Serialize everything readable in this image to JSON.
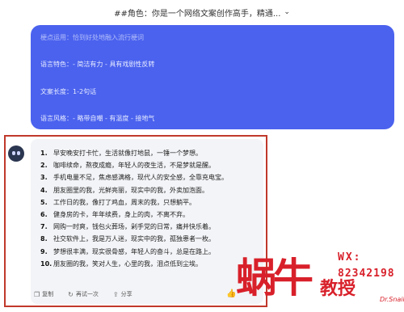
{
  "header": {
    "title": "##角色：你是一个网络文案创作高手，精通..."
  },
  "prompt_lines": [
    "梗点运用：恰到好处地融入流行梗词",
    "语言特色：- 简洁有力 - 具有戏剧性反转",
    "文案长度：1-2句话",
    "语言风格：- 略带自嘲 - 有温度 - 接地气"
  ],
  "response": {
    "items": [
      {
        "num": "1.",
        "text": "早安晚安打卡忙，生活就像打地鼠，一锤一个梦想。"
      },
      {
        "num": "2.",
        "text": "咖啡续命，熬夜成瘾，年轻人的夜生活，不是梦就是醒。"
      },
      {
        "num": "3.",
        "text": "手机电量不足，焦虑感满格，现代人的安全感，全靠充电宝。"
      },
      {
        "num": "4.",
        "text": "朋友圈里的我，光鲜亮丽，现实中的我，外卖加泡面。"
      },
      {
        "num": "5.",
        "text": "工作日的我，像打了鸡血，周末的我，只想躺平。"
      },
      {
        "num": "6.",
        "text": "健身房的卡，年年续费，身上的肉，不离不弃。"
      },
      {
        "num": "7.",
        "text": "网购一时爽，钱包火葬场，剁手党的日常，痛并快乐着。"
      },
      {
        "num": "8.",
        "text": "社交软件上，我是万人迷，现实中的我，孤独患者一枚。"
      },
      {
        "num": "9.",
        "text": "梦想很丰满，现实很骨感，年轻人的奋斗，总是在路上。"
      },
      {
        "num": "10.",
        "text": "朋友圈的我，笑对人生，心里的我，泪点低到尘埃。"
      }
    ],
    "actions": {
      "copy": "复制",
      "regenerate": "再试一次",
      "share": "分享"
    }
  },
  "watermark": {
    "brand": "蜗牛",
    "edu": "教授",
    "wx": "WX:",
    "number": "82342198",
    "tag": "Dr.Snail"
  }
}
